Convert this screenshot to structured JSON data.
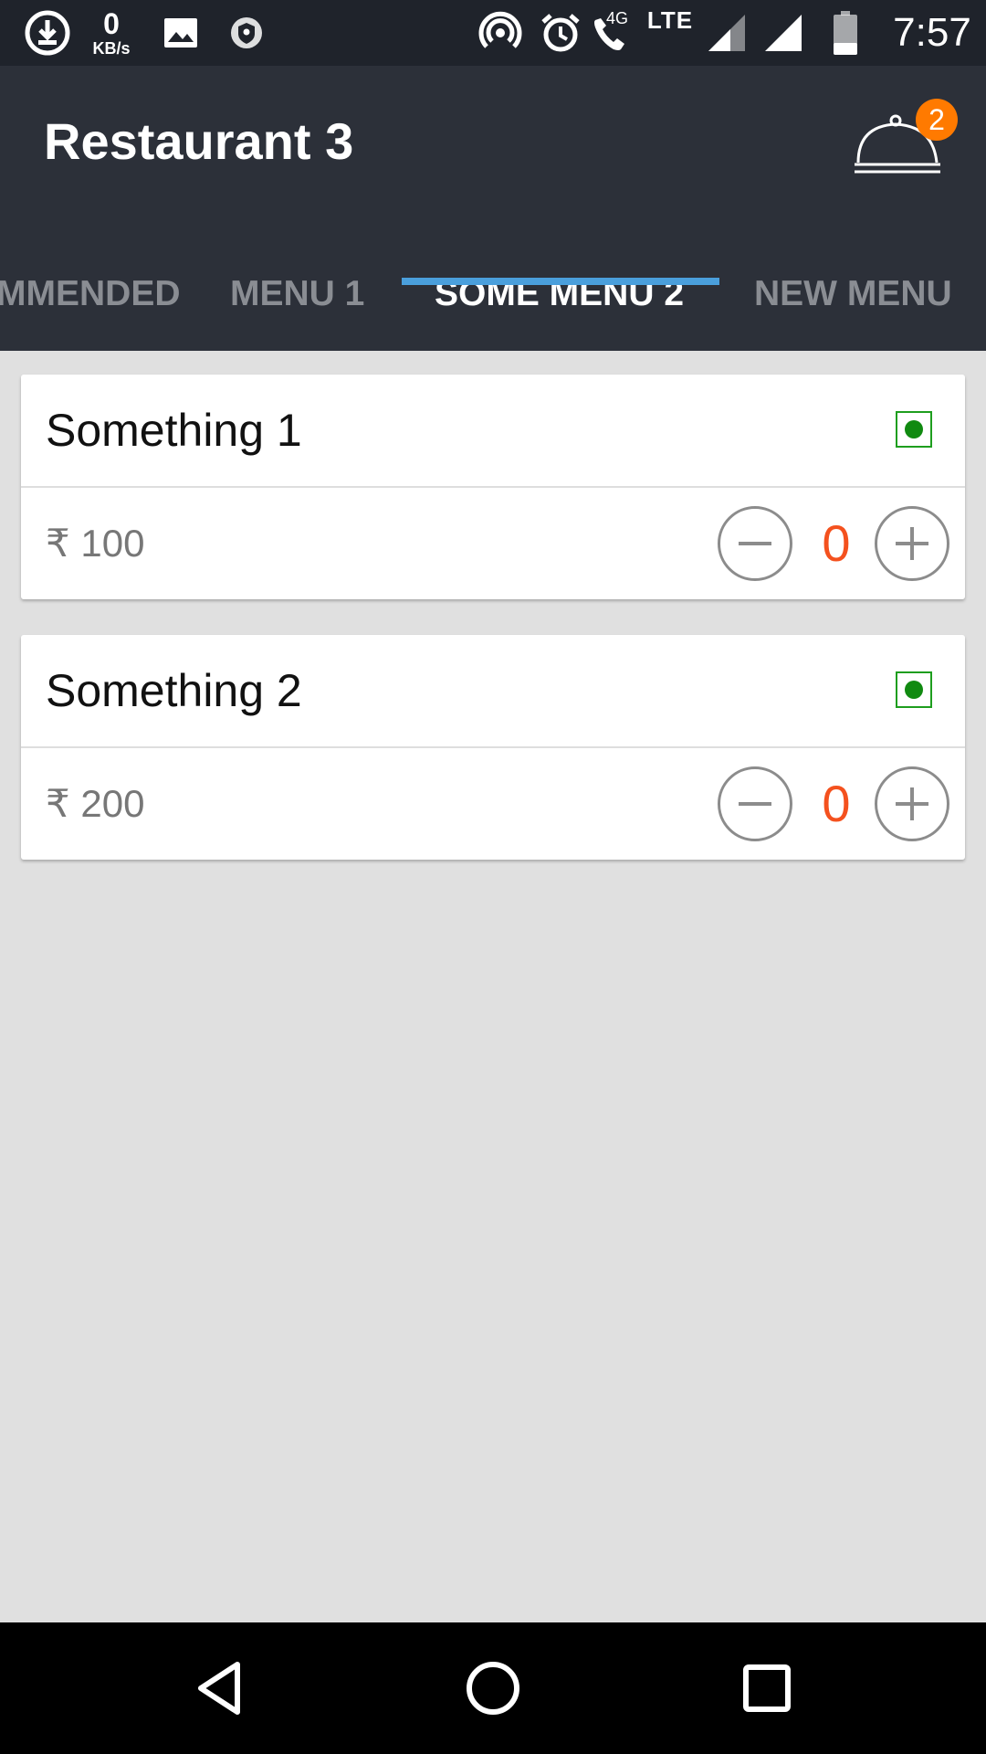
{
  "status_bar": {
    "net_speed_value": "0",
    "net_speed_unit": "KB/s",
    "network_type": "LTE",
    "call_network": "4G",
    "time": "7:57",
    "icons": [
      "download-icon",
      "image-icon",
      "vpn-shield-icon",
      "hotspot-icon",
      "alarm-icon",
      "volte-call-icon",
      "signal-icon",
      "battery-icon"
    ]
  },
  "app_bar": {
    "title": "Restaurant 3",
    "cart_count": "2"
  },
  "tabs": [
    {
      "label": "MMENDED",
      "active": false
    },
    {
      "label": "MENU 1",
      "active": false
    },
    {
      "label": "SOME MENU 2",
      "active": true
    },
    {
      "label": "NEW MENU",
      "active": false
    }
  ],
  "items": [
    {
      "name": "Something 1",
      "price": "₹ 100",
      "quantity": "0",
      "veg": true
    },
    {
      "name": "Something 2",
      "price": "₹ 200",
      "quantity": "0",
      "veg": true
    }
  ],
  "colors": {
    "status_bar_bg": "#1f232b",
    "app_bar_bg": "#2c3039",
    "tab_indicator": "#4a9fdc",
    "badge": "#ff7a00",
    "quantity": "#f4511e",
    "veg_green": "#108a10",
    "page_bg": "#e0e0e0"
  },
  "nav_bar": {
    "icons": [
      "back-icon",
      "home-icon",
      "recents-icon"
    ]
  }
}
